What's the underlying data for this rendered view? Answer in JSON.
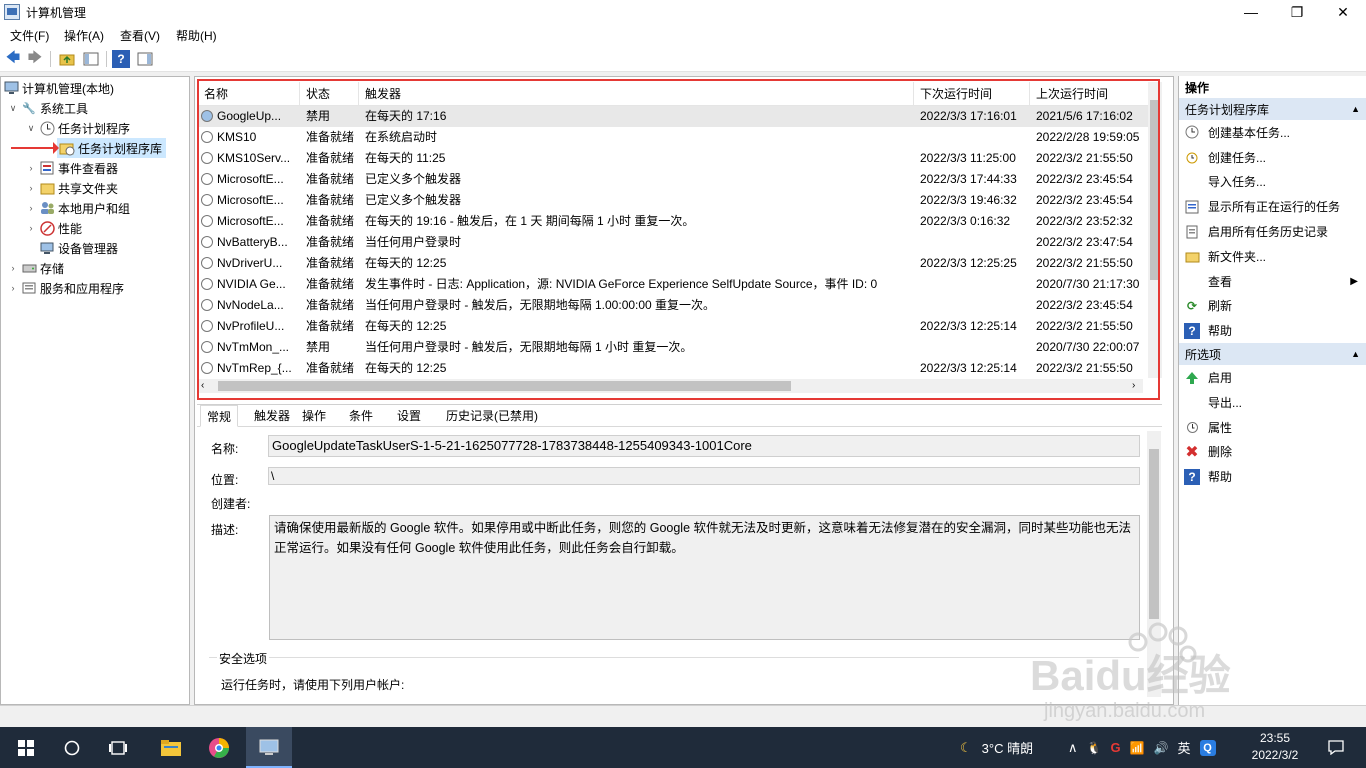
{
  "window": {
    "title": "计算机管理",
    "min": "—",
    "max": "❐",
    "close": "✕"
  },
  "menu": [
    "文件(F)",
    "操作(A)",
    "查看(V)",
    "帮助(H)"
  ],
  "toolbar": {
    "back": "🡄",
    "forward": "🡆",
    "help": "?"
  },
  "tree": {
    "root": "计算机管理(本地)",
    "system_tools": "系统工具",
    "scheduler": "任务计划程序",
    "scheduler_lib": "任务计划程序库",
    "event_viewer": "事件查看器",
    "shared_folders": "共享文件夹",
    "local_users": "本地用户和组",
    "performance": "性能",
    "device_manager": "设备管理器",
    "storage": "存储",
    "services_apps": "服务和应用程序"
  },
  "table": {
    "headers": [
      "名称",
      "状态",
      "触发器",
      "下次运行时间",
      "上次运行时间"
    ],
    "rows": [
      {
        "name": "GoogleUp...",
        "status": "禁用",
        "trigger": "在每天的 17:16",
        "next": "2022/3/3 17:16:01",
        "last": "2021/5/6 17:16:02"
      },
      {
        "name": "KMS10",
        "status": "准备就绪",
        "trigger": "在系统启动时",
        "next": "",
        "last": "2022/2/28 19:59:05"
      },
      {
        "name": "KMS10Serv...",
        "status": "准备就绪",
        "trigger": "在每天的 11:25",
        "next": "2022/3/3 11:25:00",
        "last": "2022/3/2 21:55:50"
      },
      {
        "name": "MicrosoftE...",
        "status": "准备就绪",
        "trigger": "已定义多个触发器",
        "next": "2022/3/3 17:44:33",
        "last": "2022/3/2 23:45:54"
      },
      {
        "name": "MicrosoftE...",
        "status": "准备就绪",
        "trigger": "已定义多个触发器",
        "next": "2022/3/3 19:46:32",
        "last": "2022/3/2 23:45:54"
      },
      {
        "name": "MicrosoftE...",
        "status": "准备就绪",
        "trigger": "在每天的 19:16 - 触发后，在 1 天 期间每隔 1 小时 重复一次。",
        "next": "2022/3/3 0:16:32",
        "last": "2022/3/2 23:52:32"
      },
      {
        "name": "NvBatteryB...",
        "status": "准备就绪",
        "trigger": "当任何用户登录时",
        "next": "",
        "last": "2022/3/2 23:47:54"
      },
      {
        "name": "NvDriverU...",
        "status": "准备就绪",
        "trigger": "在每天的 12:25",
        "next": "2022/3/3 12:25:25",
        "last": "2022/3/2 21:55:50"
      },
      {
        "name": "NVIDIA Ge...",
        "status": "准备就绪",
        "trigger": "发生事件时 - 日志: Application，源: NVIDIA GeForce Experience SelfUpdate Source，事件 ID: 0",
        "next": "",
        "last": "2020/7/30 21:17:30"
      },
      {
        "name": "NvNodeLa...",
        "status": "准备就绪",
        "trigger": "当任何用户登录时 - 触发后，无限期地每隔 1.00:00:00 重复一次。",
        "next": "",
        "last": "2022/3/2 23:45:54"
      },
      {
        "name": "NvProfileU...",
        "status": "准备就绪",
        "trigger": "在每天的 12:25",
        "next": "2022/3/3 12:25:14",
        "last": "2022/3/2 21:55:50"
      },
      {
        "name": "NvTmMon_...",
        "status": "禁用",
        "trigger": "当任何用户登录时 - 触发后，无限期地每隔 1 小时 重复一次。",
        "next": "",
        "last": "2020/7/30 22:00:07"
      },
      {
        "name": "NvTmRep_{...",
        "status": "准备就绪",
        "trigger": "在每天的 12:25",
        "next": "2022/3/3 12:25:14",
        "last": "2022/3/2 21:55:50"
      }
    ]
  },
  "detail": {
    "tabs": [
      "常规",
      "触发器",
      "操作",
      "条件",
      "设置",
      "历史记录(已禁用)"
    ],
    "name_label": "名称:",
    "name_value": "GoogleUpdateTaskUserS-1-5-21-1625077728-1783738448-1255409343-1001Core",
    "location_label": "位置:",
    "location_value": "\\",
    "author_label": "创建者:",
    "desc_label": "描述:",
    "desc_value": "请确保使用最新版的 Google 软件。如果停用或中断此任务，则您的 Google 软件就无法及时更新，这意味着无法修复潜在的安全漏洞，同时某些功能也无法正常运行。如果没有任何 Google 软件使用此任务，则此任务会自行卸载。",
    "security_label": "安全选项",
    "run_as_label": "运行任务时，请使用下列用户帐户:"
  },
  "actions": {
    "title": "操作",
    "section1": "任务计划程序库",
    "items1": [
      "创建基本任务...",
      "创建任务...",
      "导入任务...",
      "显示所有正在运行的任务",
      "启用所有任务历史记录",
      "新文件夹...",
      "查看",
      "刷新",
      "帮助"
    ],
    "section2": "所选项",
    "items2": [
      "启用",
      "导出...",
      "属性",
      "删除",
      "帮助"
    ]
  },
  "taskbar": {
    "weather": "3°C 晴朗",
    "ime": "英",
    "time": "23:55",
    "date": "2022/3/2"
  },
  "watermark": {
    "brand": "Baidu经验",
    "url": "jingyan.baidu.com"
  },
  "colors": {
    "selection": "#cce8ff",
    "section": "#dce7f4",
    "highlight": "#e53935",
    "taskbar": "#1f2b3a"
  }
}
